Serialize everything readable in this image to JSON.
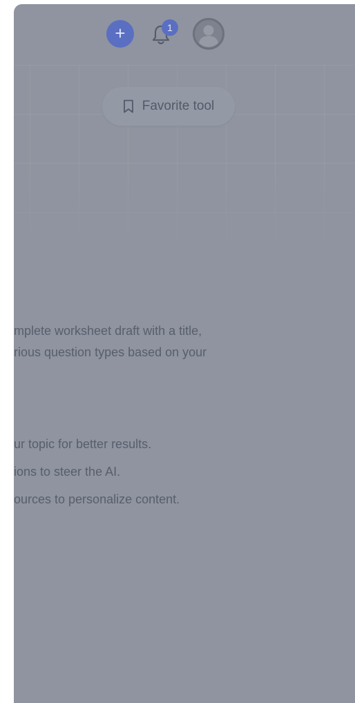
{
  "header": {
    "add_button_glyph": "+",
    "notification_count": "1"
  },
  "favorite": {
    "label": "Favorite tool"
  },
  "description": {
    "line1": "mplete worksheet draft with a title,",
    "line2": "rious question types based on your"
  },
  "tips": [
    "ur topic for better results.",
    "ions to steer the AI.",
    "ources to personalize content."
  ],
  "colors": {
    "overlay": "#8f94a0",
    "accent": "#5a6fc2",
    "text": "#585e6c"
  },
  "icons": {
    "add": "plus-icon",
    "notifications": "bell-icon",
    "profile": "user-avatar-icon",
    "favorite": "bookmark-icon"
  }
}
